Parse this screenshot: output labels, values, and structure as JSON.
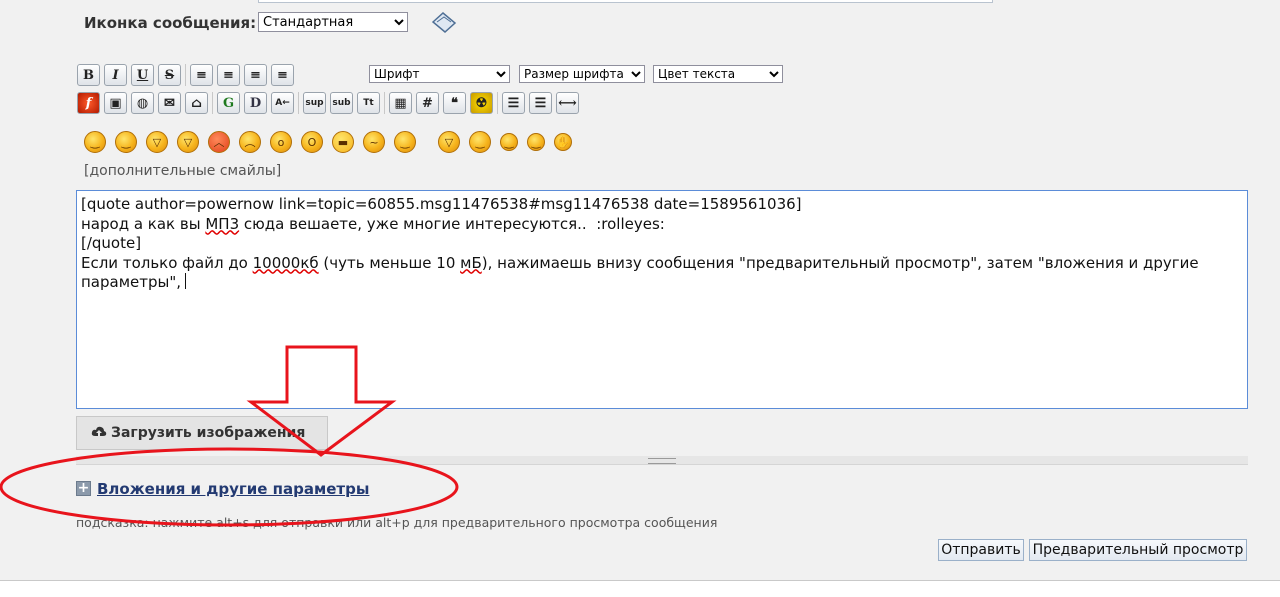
{
  "message_icon": {
    "label": "Иконка сообщения:",
    "selected": "Стандартная",
    "preview_icon": "message-icon-preview"
  },
  "toolbar": {
    "formatting_buttons": [
      {
        "name": "bold-button",
        "glyph": "B",
        "icon": "bold-icon"
      },
      {
        "name": "italic-button",
        "glyph": "I",
        "icon": "italic-icon"
      },
      {
        "name": "underline-button",
        "glyph": "U",
        "icon": "underline-icon"
      },
      {
        "name": "strikethrough-button",
        "glyph": "S",
        "icon": "strikethrough-icon"
      },
      {
        "name": "align-left-button",
        "glyph": "≡",
        "icon": "align-left-icon"
      },
      {
        "name": "align-justify-button",
        "glyph": "≡",
        "icon": "align-justify-icon"
      },
      {
        "name": "align-center-button",
        "glyph": "≡",
        "icon": "align-center-icon"
      },
      {
        "name": "align-right-button",
        "glyph": "≡",
        "icon": "align-right-icon"
      }
    ],
    "font_select": "Шрифт",
    "size_select": "Размер шрифта",
    "color_select": "Цвет текста",
    "insert_buttons": [
      {
        "name": "flash-button",
        "glyph": "f",
        "icon": "flash-icon"
      },
      {
        "name": "image-button",
        "glyph": "▣",
        "icon": "image-icon"
      },
      {
        "name": "link-button",
        "glyph": "◍",
        "icon": "globe-link-icon"
      },
      {
        "name": "email-button",
        "glyph": "✉",
        "icon": "email-icon"
      },
      {
        "name": "ftp-button",
        "glyph": "⌂",
        "icon": "ftp-icon"
      },
      {
        "name": "glow-button",
        "glyph": "G",
        "icon": "glow-icon"
      },
      {
        "name": "shadow-button",
        "glyph": "D",
        "icon": "shadow-icon"
      },
      {
        "name": "move-button",
        "glyph": "A←",
        "icon": "marquee-icon"
      },
      {
        "name": "superscript-button",
        "glyph": "sup",
        "icon": "superscript-icon"
      },
      {
        "name": "subscript-button",
        "glyph": "sub",
        "icon": "subscript-icon"
      },
      {
        "name": "teletype-button",
        "glyph": "Tt",
        "icon": "teletype-icon"
      },
      {
        "name": "table-button",
        "glyph": "▦",
        "icon": "table-icon"
      },
      {
        "name": "code-button",
        "glyph": "#",
        "icon": "code-icon"
      },
      {
        "name": "quote-button",
        "glyph": "❝",
        "icon": "quote-icon"
      },
      {
        "name": "hide-button",
        "glyph": "☢",
        "icon": "radiation-icon"
      },
      {
        "name": "unordered-list-button",
        "glyph": "☰",
        "icon": "bullet-list-icon"
      },
      {
        "name": "ordered-list-button",
        "glyph": "☰",
        "icon": "numbered-list-icon"
      },
      {
        "name": "horizontal-rule-button",
        "glyph": "⟷",
        "icon": "horizontal-rule-icon"
      }
    ]
  },
  "smileys": [
    {
      "name": "smiley-smile",
      "glyph": "‿"
    },
    {
      "name": "smiley-wink",
      "glyph": "‿"
    },
    {
      "name": "smiley-cheesy",
      "glyph": "▽"
    },
    {
      "name": "smiley-grin",
      "glyph": "▽"
    },
    {
      "name": "smiley-angry",
      "glyph": "︿"
    },
    {
      "name": "smiley-sad",
      "glyph": "︵"
    },
    {
      "name": "smiley-shocked",
      "glyph": "o"
    },
    {
      "name": "smiley-surprised",
      "glyph": "O"
    },
    {
      "name": "smiley-cool",
      "glyph": "▬"
    },
    {
      "name": "smiley-huh",
      "glyph": "~"
    },
    {
      "name": "smiley-rolleyes",
      "glyph": "‿"
    },
    {
      "name": "smiley-tongue",
      "glyph": "▽"
    },
    {
      "name": "smiley-embarrassed",
      "glyph": "‿"
    },
    {
      "name": "smiley-lipsrsealed",
      "glyph": "‿"
    },
    {
      "name": "smiley-undecided",
      "glyph": "‿"
    },
    {
      "name": "smiley-facepalm",
      "glyph": "✋"
    }
  ],
  "more_smileys_link": "[дополнительные смайлы]",
  "editor": {
    "line1": "[quote author=powernow link=topic=60855.msg11476538#msg11476538 date=1589561036]",
    "line2_before": "народ а как вы ",
    "line2_spell": "МП3",
    "line2_after": " сюда вешаете, уже многие интересуются..  :rolleyes:",
    "line3": "[/quote]",
    "line4_a": "Если только файл до ",
    "line4_spell1": "10000кб",
    "line4_b": " (чуть меньше 10 ",
    "line4_spell2": "мБ",
    "line4_c": "), нажимаешь внизу сообщения \"предварительный просмотр\", затем \"вложения и другие",
    "line5": "параметры\","
  },
  "upload_button": "Загрузить изображения",
  "attachments_link": "Вложения и другие параметры",
  "hint": "подсказка: нажмите alt+s для отправки или alt+p для предварительного просмотра сообщения",
  "submit_button": "Отправить",
  "preview_button": "Предварительный просмотр",
  "colors": {
    "annotation": "#e8141c",
    "link": "#233a72",
    "editor_border": "#5b8cd8"
  }
}
